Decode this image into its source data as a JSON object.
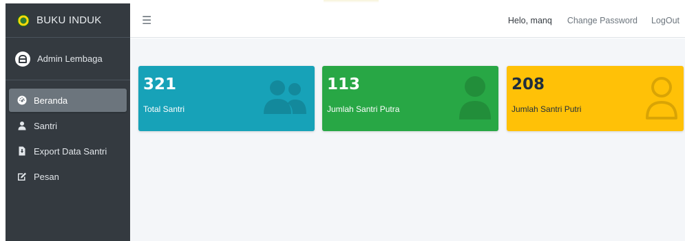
{
  "sidebar": {
    "brand": "BUKU INDUK",
    "user": "Admin Lembaga",
    "items": [
      {
        "label": "Beranda",
        "icon": "dashboard-icon",
        "active": true
      },
      {
        "label": "Santri",
        "icon": "user-icon",
        "active": false
      },
      {
        "label": "Export Data Santri",
        "icon": "file-download-icon",
        "active": false
      },
      {
        "label": "Pesan",
        "icon": "edit-icon",
        "active": false
      }
    ]
  },
  "topbar": {
    "menu_icon": "hamburger-icon",
    "greeting": "Helo, manq",
    "change_password": "Change Password",
    "logout": "LogOut"
  },
  "stats": [
    {
      "value": "321",
      "label": "Total Santri",
      "icon": "users-icon",
      "color": "#17a2b8"
    },
    {
      "value": "113",
      "label": "Jumlah Santri Putra",
      "icon": "user-icon",
      "color": "#28a745"
    },
    {
      "value": "208",
      "label": "Jumlah Santri Putri",
      "icon": "user-outline-icon",
      "color": "#ffc107"
    }
  ]
}
